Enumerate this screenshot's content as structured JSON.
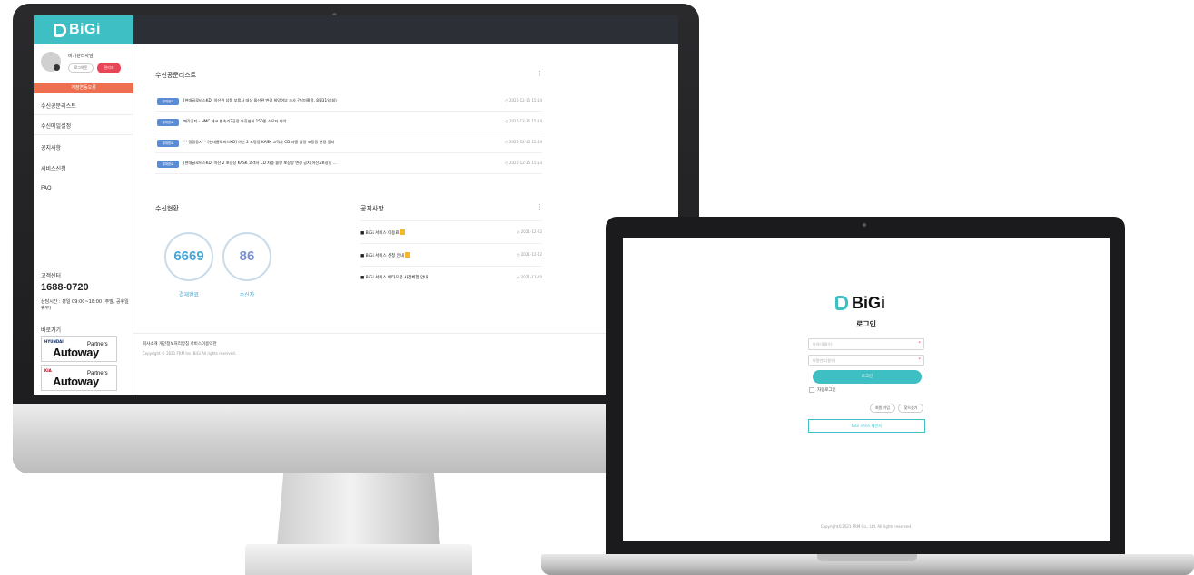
{
  "admin": {
    "logo": "BiGi",
    "user_name": "비기관리자님",
    "logout_label": "로그아웃",
    "admin_label": "관리자",
    "menu_bar_label": "계정연동오류",
    "menu": [
      "수신공문리스트",
      "수신메일설정",
      "공지사항",
      "서비스신청",
      "FAQ"
    ],
    "cs": {
      "title": "고객센터",
      "phone": "1688-0720",
      "hours": "상담시간 : 평일 09:00~18:00 (주말, 공휴일 휴무)"
    },
    "quick": {
      "title": "바로가기",
      "links": [
        {
          "brand": "HYUNDAI",
          "name": "Autoway",
          "sub": "Partners",
          "color": "#0a2d6e"
        },
        {
          "brand": "KIA",
          "name": "Autoway",
          "sub": "Partners",
          "color": "#c30a20"
        }
      ]
    },
    "received": {
      "title": "수신공문리스트",
      "rows": [
        {
          "badge": "결재완료",
          "text": "[현대글로비스KD] 아산권 납품 부품사 대상 물산관 변경 희망여부 조사 건 (미확정, 8월31일 회)",
          "date": "2021-12-15 15:14"
        },
        {
          "badge": "결재완료",
          "text": "폐각공지 - HMC 체코 변속기2공장 유휴설비 150종 소모저 파악",
          "date": "2021-12-15 15:14"
        },
        {
          "badge": "결재완료",
          "text": "** 정정공지** [현대글로비스KD] 아산 2 포장장 KASK 고객사 CD 자중 물량 포장장 변경 공지",
          "date": "2021-12-15 15:14"
        },
        {
          "badge": "결재완료",
          "text": "[현대글로비스KD] 아산 2 포장장 KASK 고객사 CD 자중 물량 포장장 변경 공지(아산2포장장 ...",
          "date": "2021-12-15 15:13"
        }
      ]
    },
    "stats": {
      "title": "수신현황",
      "approved_value": "6669",
      "approved_label": "결재완료",
      "recipient_value": "86",
      "recipient_label": "수신자"
    },
    "notices": {
      "title": "공지사항",
      "rows": [
        {
          "text": "■ BiGi 서비스 이용료",
          "date": "2021-12-22"
        },
        {
          "text": "■ BiGi 서비스 신청 안내",
          "date": "2021-12-22"
        },
        {
          "text": "■ BiGi 서비스 베타오픈 사전체험 안내",
          "date": "2021-12-20"
        }
      ]
    },
    "footer": {
      "links": "회사소개   개인정보처리방침   서비스이용약관",
      "copyright": "Copyright © 2021 FRM Inc. BiGi All rights reserved."
    }
  },
  "login": {
    "logo": "BiGi",
    "title": "로그인",
    "id_placeholder": "아이디(필수)",
    "pw_placeholder": "비밀번호(필수)",
    "login_button": "로그인",
    "auto_login": "자동로그인",
    "signup": "회원 가입",
    "find_password": "찾으셨기",
    "proposal": "BiGi 서비스 제안서",
    "copyright": "Copyright©2021 FRM Co., Ltd. All rights reserved."
  },
  "colors": {
    "accent": "#3dbfc3",
    "topbar": "#2c2f36",
    "menu_bar": "#ee6f50",
    "admin_button": "#e94558",
    "badge": "#5a8cd6",
    "circle_approved": "#4aa7d6",
    "circle_recipient": "#7b8fcf"
  }
}
